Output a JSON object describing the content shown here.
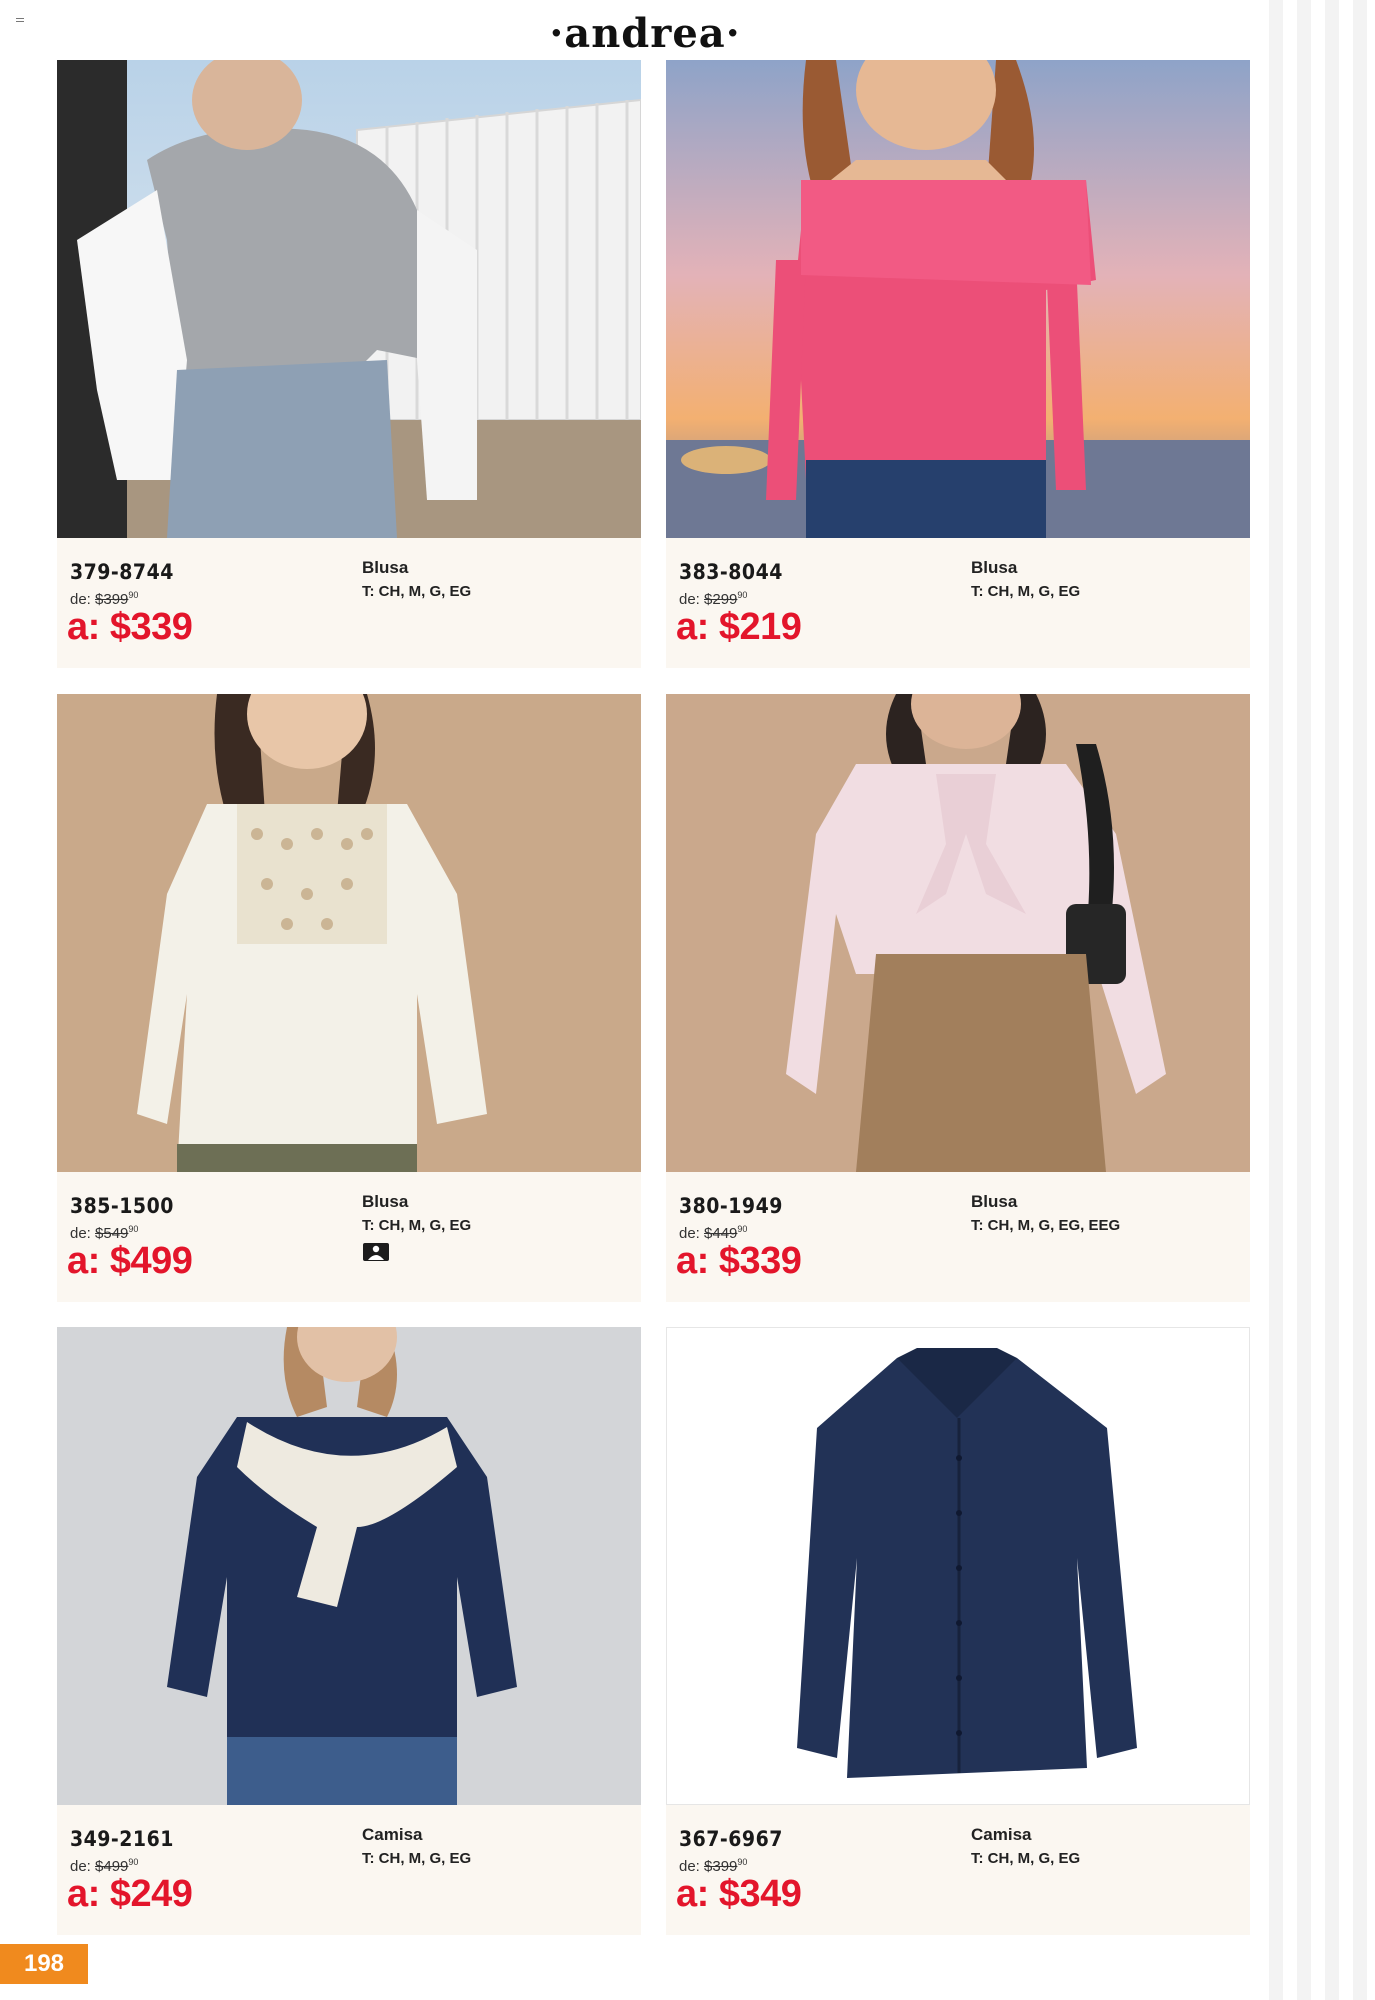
{
  "brand": "·andrea·",
  "page_number": "198",
  "products": [
    {
      "sku": "379-8744",
      "old_label": "de:",
      "old_price": "$399",
      "old_cents": "90",
      "new_price": "a: $339",
      "type": "Blusa",
      "sizes": "T: CH, M, G, EG"
    },
    {
      "sku": "383-8044",
      "old_label": "de:",
      "old_price": "$299",
      "old_cents": "90",
      "new_price": "a: $219",
      "type": "Blusa",
      "sizes": "T: CH, M, G, EG"
    },
    {
      "sku": "385-1500",
      "old_label": "de:",
      "old_price": "$549",
      "old_cents": "90",
      "new_price": "a: $499",
      "type": "Blusa",
      "sizes": "T: CH, M, G, EG"
    },
    {
      "sku": "380-1949",
      "old_label": "de:",
      "old_price": "$449",
      "old_cents": "90",
      "new_price": "a: $339",
      "type": "Blusa",
      "sizes": "T: CH, M, G, EG, EEG"
    },
    {
      "sku": "349-2161",
      "old_label": "de:",
      "old_price": "$499",
      "old_cents": "90",
      "new_price": "a: $249",
      "type": "Camisa",
      "sizes": "T: CH, M, G, EG"
    },
    {
      "sku": "367-6967",
      "old_label": "de:",
      "old_price": "$399",
      "old_cents": "90",
      "new_price": "a: $349",
      "type": "Camisa",
      "sizes": "T: CH, M, G, EG"
    }
  ],
  "icons": {
    "plus_size": "plus-size-icon"
  },
  "colors": {
    "sale_red": "#e3152b",
    "page_badge": "#f08a1e",
    "info_bg": "#fbf7f1"
  }
}
